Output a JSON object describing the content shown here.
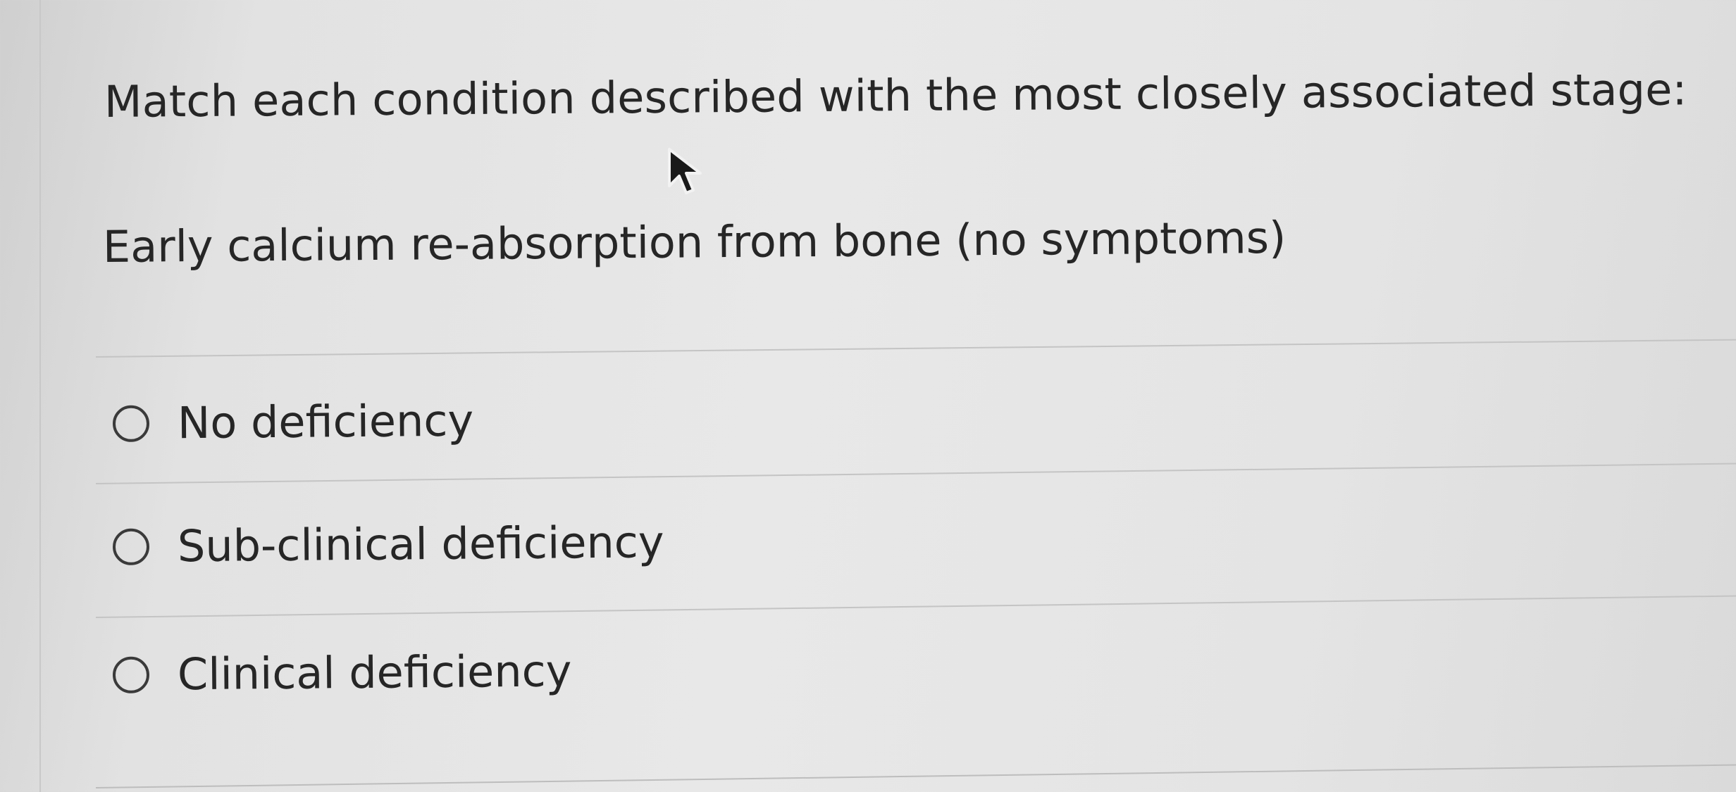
{
  "question": {
    "prompt": "Match each condition described with the most closely associated stage:",
    "item": "Early calcium re-absorption from bone (no symptoms)"
  },
  "options": [
    {
      "label": "No deficiency",
      "selected": false
    },
    {
      "label": "Sub-clinical deficiency",
      "selected": false
    },
    {
      "label": "Clinical deficiency",
      "selected": false
    }
  ],
  "icons": {
    "cursor": "mouse-pointer-arrow-icon",
    "radio": "radio-button-unchecked-icon"
  }
}
